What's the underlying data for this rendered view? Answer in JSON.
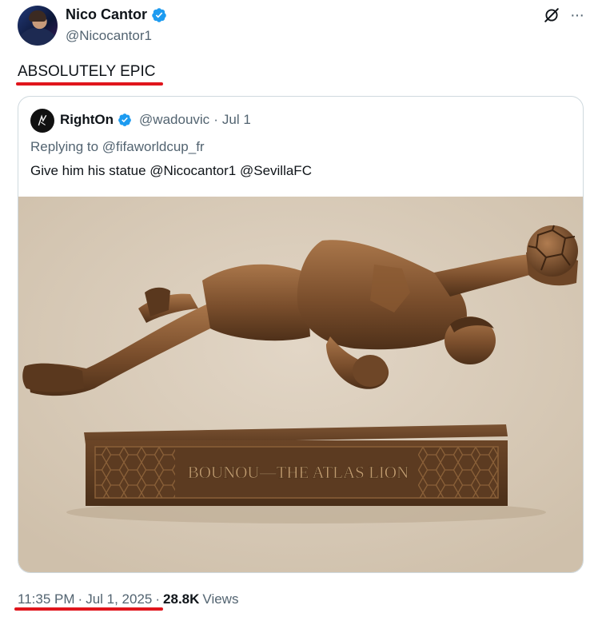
{
  "author": {
    "display_name": "Nico Cantor",
    "handle": "@Nicocantor1",
    "verified_color": "#1d9bf0"
  },
  "actions": {
    "grok_icon": "grok-icon",
    "more_icon": "more-icon",
    "more_label": "···"
  },
  "tweet": {
    "text": "ABSOLUTELY EPIC",
    "highlight_color": "#e0151c"
  },
  "quote": {
    "display_name": "RightOn",
    "handle": "@wadouvic",
    "separator": "·",
    "date": "Jul 1",
    "replying_prefix": "Replying to ",
    "replying_to": "@fifaworldcup_fr",
    "text": "Give him his statue @Nicocantor1 @SevillaFC",
    "image": {
      "description_icon": "statue-image",
      "plinth_inscription": "BOUNOU—THE ATLAS LION"
    }
  },
  "footer": {
    "time": "11:35 PM",
    "separator": "·",
    "date": "Jul 1, 2025",
    "views_count": "28.8K",
    "views_label": "Views"
  }
}
